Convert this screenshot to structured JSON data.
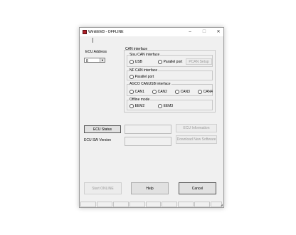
{
  "window": {
    "title": "WinEEM3 - OFFLINE",
    "controls": {
      "minimize": "–",
      "maximize": "☐",
      "close": "✕"
    }
  },
  "ecu_address": {
    "label": "ECU Address",
    "value": "8"
  },
  "can_interface": {
    "title": "CAN interface",
    "sisu": {
      "title": "Sisu CAN interface",
      "usb": "USB",
      "parallel": "Parallel port",
      "setup_button": "PCAN Setup"
    },
    "nf": {
      "title": "NF CAN interface",
      "parallel": "Parallel port"
    },
    "agco": {
      "title": "AGCO CANUSB interface",
      "options": [
        "CAN1",
        "CAN2",
        "CAN3",
        "CAN4"
      ]
    },
    "offline": {
      "title": "Offline mode",
      "options": [
        "EEM2",
        "EEM3"
      ]
    }
  },
  "ecu_status": {
    "button": "ECU Status",
    "info_button": "ECU Information"
  },
  "ecu_sw": {
    "label": "ECU SW Version",
    "download_button": "Download New Software"
  },
  "bottom": {
    "start_online": "Start ONLINE",
    "help": "Help",
    "cancel": "Cancel"
  },
  "status_bar": {
    "cells": [
      "",
      "",
      "",
      "",
      "",
      "",
      "",
      "",
      ""
    ]
  }
}
